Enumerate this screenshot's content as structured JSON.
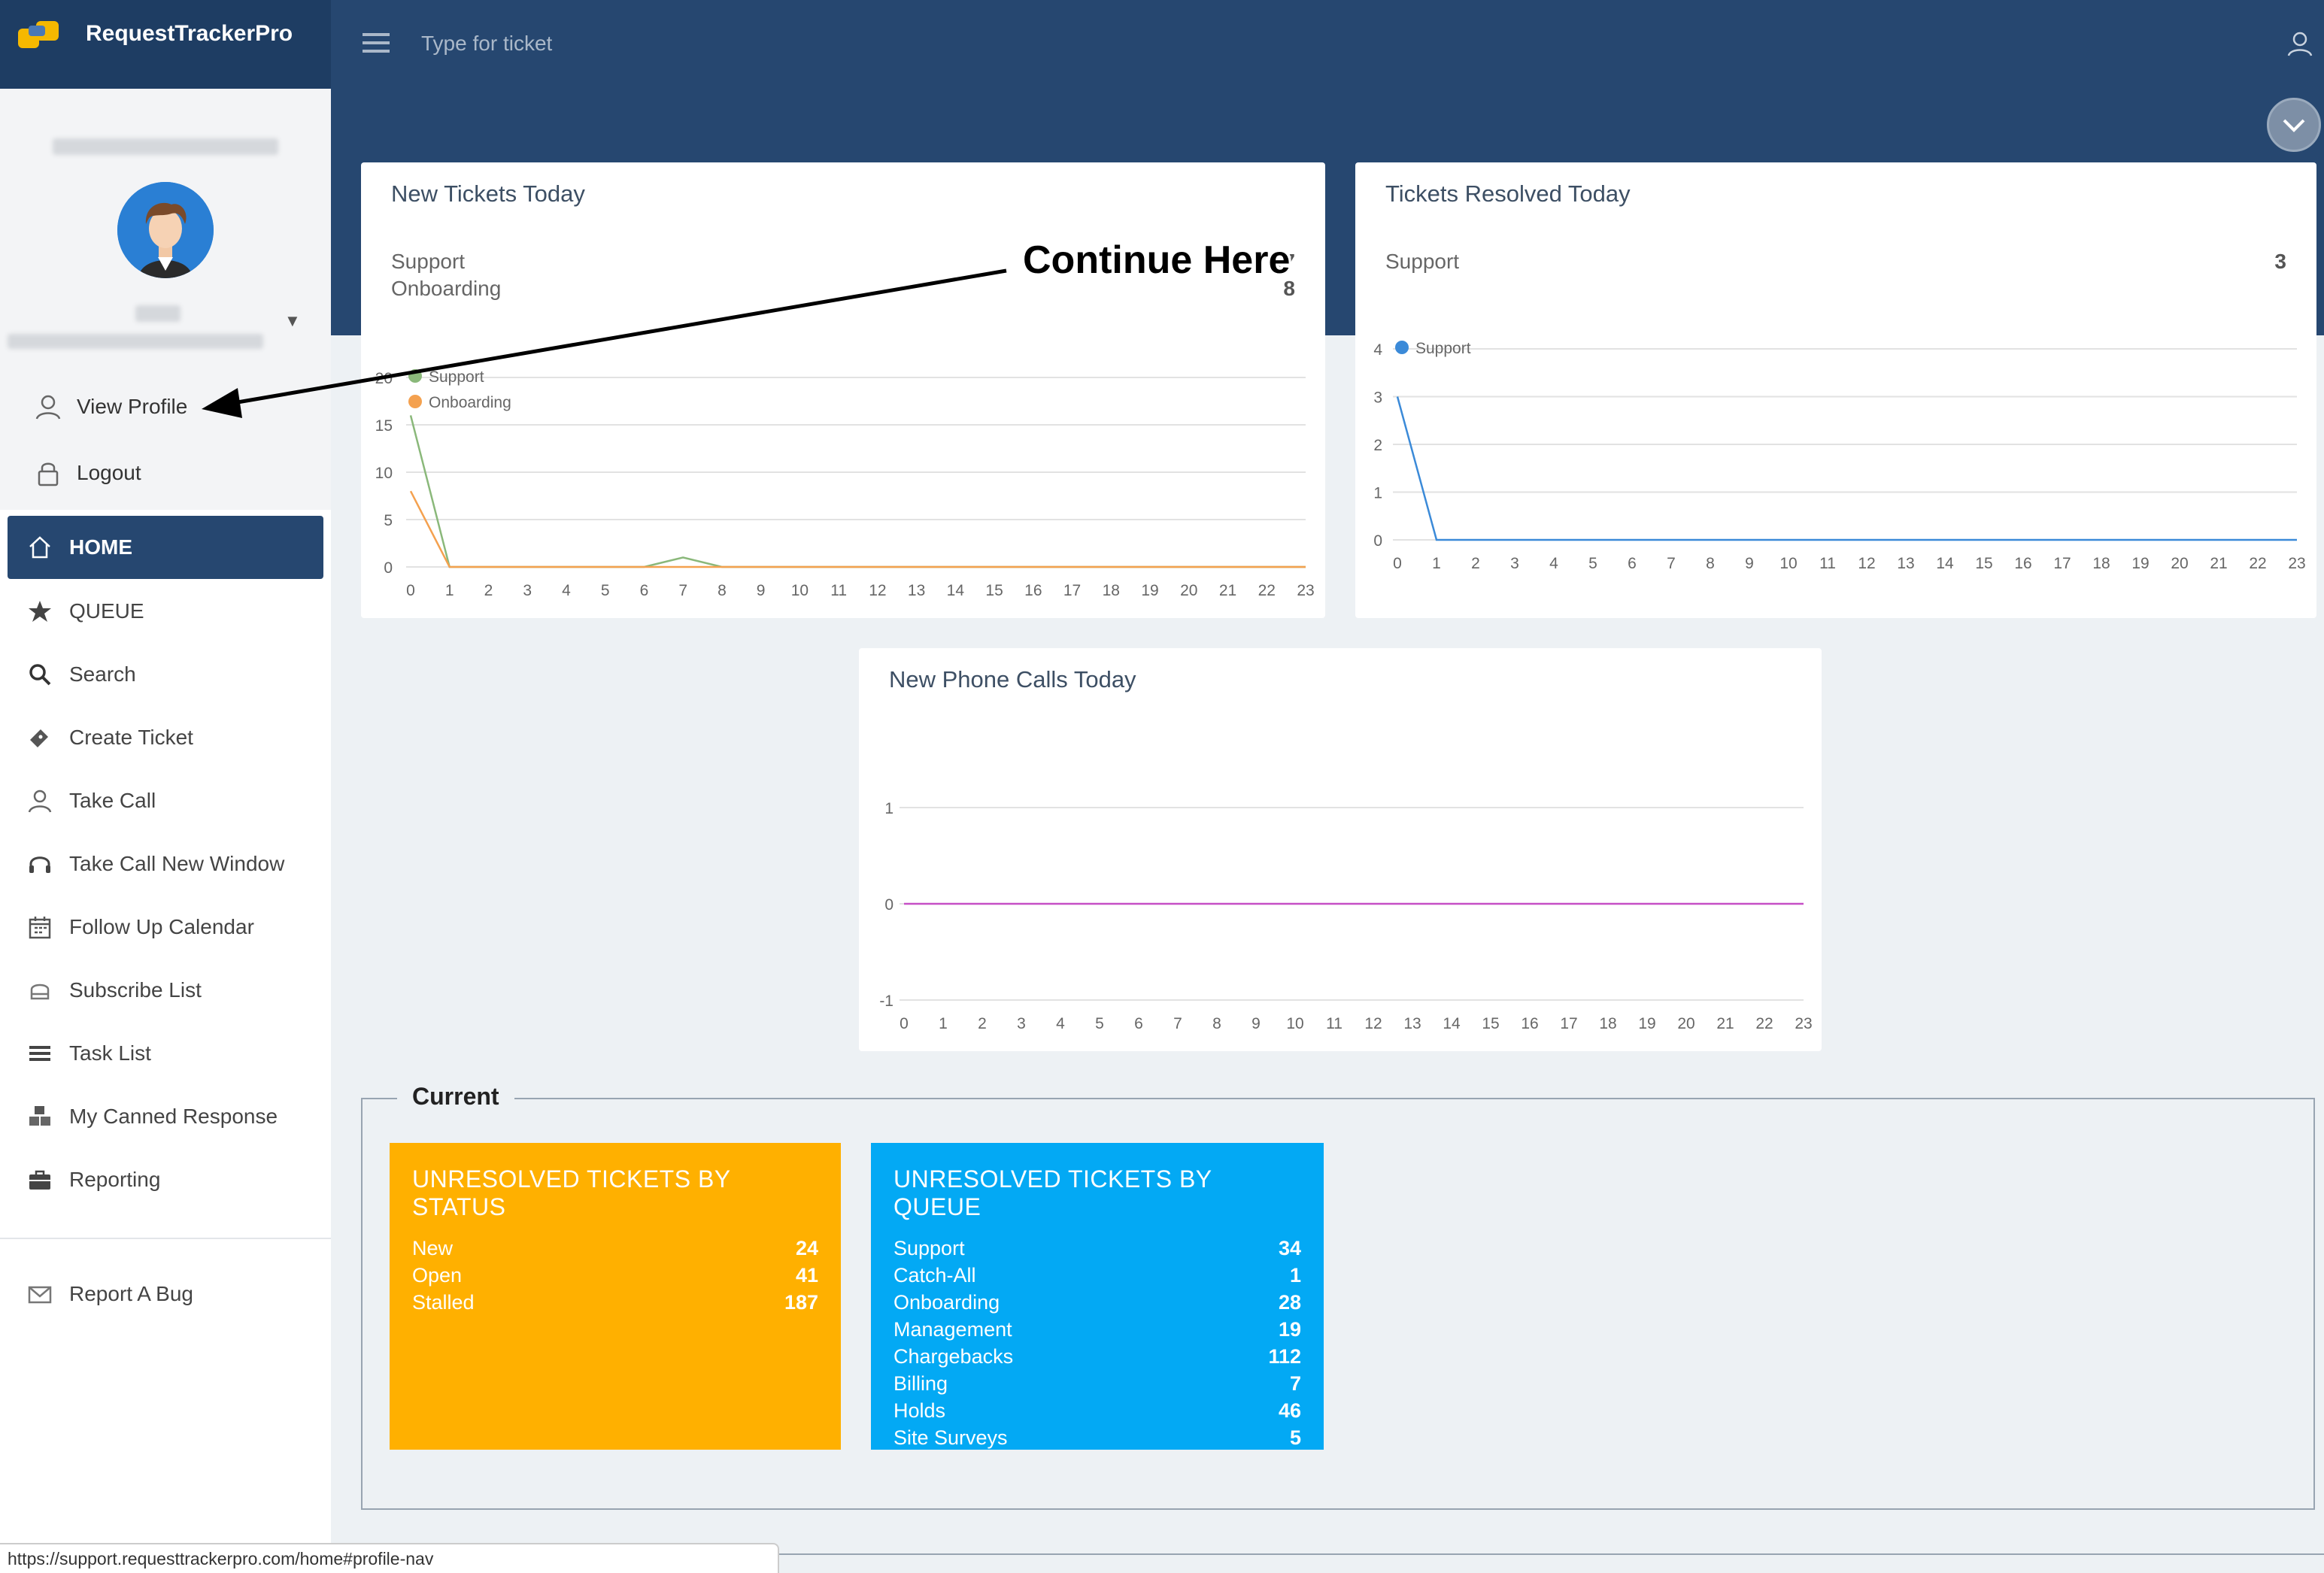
{
  "app": {
    "title": "RequestTrackerPro"
  },
  "header": {
    "search_placeholder": "Type for ticket"
  },
  "profile": {
    "links": [
      {
        "label": "View Profile"
      },
      {
        "label": "Logout"
      }
    ]
  },
  "nav": {
    "home": "HOME",
    "items": [
      {
        "label": "QUEUE"
      },
      {
        "label": "Search"
      },
      {
        "label": "Create Ticket"
      },
      {
        "label": "Take Call"
      },
      {
        "label": "Take Call New Window"
      },
      {
        "label": "Follow Up Calendar"
      },
      {
        "label": "Subscribe List"
      },
      {
        "label": "Task List"
      },
      {
        "label": "My Canned Response"
      },
      {
        "label": "Reporting"
      }
    ],
    "report_bug": "Report A Bug"
  },
  "panels": {
    "new_tickets": {
      "title": "New Tickets Today",
      "rows": [
        {
          "label": "Support",
          "value": "17"
        },
        {
          "label": "Onboarding",
          "value": "8"
        }
      ]
    },
    "resolved": {
      "title": "Tickets Resolved Today",
      "rows": [
        {
          "label": "Support",
          "value": "3"
        }
      ]
    },
    "phone_calls": {
      "title": "New Phone Calls Today"
    }
  },
  "current": {
    "title": "Current",
    "by_status": {
      "title": "UNRESOLVED TICKETS BY STATUS",
      "rows": [
        {
          "label": "New",
          "value": "24"
        },
        {
          "label": "Open",
          "value": "41"
        },
        {
          "label": "Stalled",
          "value": "187"
        }
      ]
    },
    "by_queue": {
      "title": "UNRESOLVED TICKETS BY QUEUE",
      "rows": [
        {
          "label": "Support",
          "value": "34"
        },
        {
          "label": "Catch-All",
          "value": "1"
        },
        {
          "label": "Onboarding",
          "value": "28"
        },
        {
          "label": "Management",
          "value": "19"
        },
        {
          "label": "Chargebacks",
          "value": "112"
        },
        {
          "label": "Billing",
          "value": "7"
        },
        {
          "label": "Holds",
          "value": "46"
        },
        {
          "label": "Site Surveys",
          "value": "5"
        }
      ]
    }
  },
  "status_bar": {
    "url": "https://support.requesttrackerpro.com/home#profile-nav"
  },
  "annotation": {
    "text": "Continue Here"
  },
  "colors": {
    "header": "#264770",
    "status_card": "#ffb000",
    "queue_card": "#03a9f4",
    "support_series": "#8ab87a",
    "onboarding_series": "#f4a14f",
    "resolved_series": "#3b8ad8",
    "calls_series": "#c64fc6"
  },
  "chart_data": [
    {
      "type": "line",
      "title": "New Tickets Today",
      "x": [
        0,
        1,
        2,
        3,
        4,
        5,
        6,
        7,
        8,
        9,
        10,
        11,
        12,
        13,
        14,
        15,
        16,
        17,
        18,
        19,
        20,
        21,
        22,
        23
      ],
      "series": [
        {
          "name": "Support",
          "values": [
            16,
            0,
            0,
            0,
            0,
            0,
            0,
            1,
            0,
            0,
            0,
            0,
            0,
            0,
            0,
            0,
            0,
            0,
            0,
            0,
            0,
            0,
            0,
            0
          ]
        },
        {
          "name": "Onboarding",
          "values": [
            8,
            0,
            0,
            0,
            0,
            0,
            0,
            0,
            0,
            0,
            0,
            0,
            0,
            0,
            0,
            0,
            0,
            0,
            0,
            0,
            0,
            0,
            0,
            0
          ]
        }
      ],
      "ylim": [
        0,
        20
      ],
      "yticks": [
        0,
        5,
        10,
        15,
        20
      ],
      "legend": "top-left",
      "grid": true
    },
    {
      "type": "line",
      "title": "Tickets Resolved Today",
      "x": [
        0,
        1,
        2,
        3,
        4,
        5,
        6,
        7,
        8,
        9,
        10,
        11,
        12,
        13,
        14,
        15,
        16,
        17,
        18,
        19,
        20,
        21,
        22,
        23
      ],
      "series": [
        {
          "name": "Support",
          "values": [
            3,
            0,
            0,
            0,
            0,
            0,
            0,
            0,
            0,
            0,
            0,
            0,
            0,
            0,
            0,
            0,
            0,
            0,
            0,
            0,
            0,
            0,
            0,
            0
          ]
        }
      ],
      "ylim": [
        0,
        4
      ],
      "yticks": [
        0,
        1,
        2,
        3,
        4
      ],
      "legend": "top-left",
      "grid": true
    },
    {
      "type": "line",
      "title": "New Phone Calls Today",
      "x": [
        0,
        1,
        2,
        3,
        4,
        5,
        6,
        7,
        8,
        9,
        10,
        11,
        12,
        13,
        14,
        15,
        16,
        17,
        18,
        19,
        20,
        21,
        22,
        23
      ],
      "series": [
        {
          "values": [
            0,
            0,
            0,
            0,
            0,
            0,
            0,
            0,
            0,
            0,
            0,
            0,
            0,
            0,
            0,
            0,
            0,
            0,
            0,
            0,
            0,
            0,
            0,
            0
          ]
        }
      ],
      "ylim": [
        -1,
        1
      ],
      "yticks": [
        -1,
        0,
        1
      ],
      "grid": true
    }
  ]
}
